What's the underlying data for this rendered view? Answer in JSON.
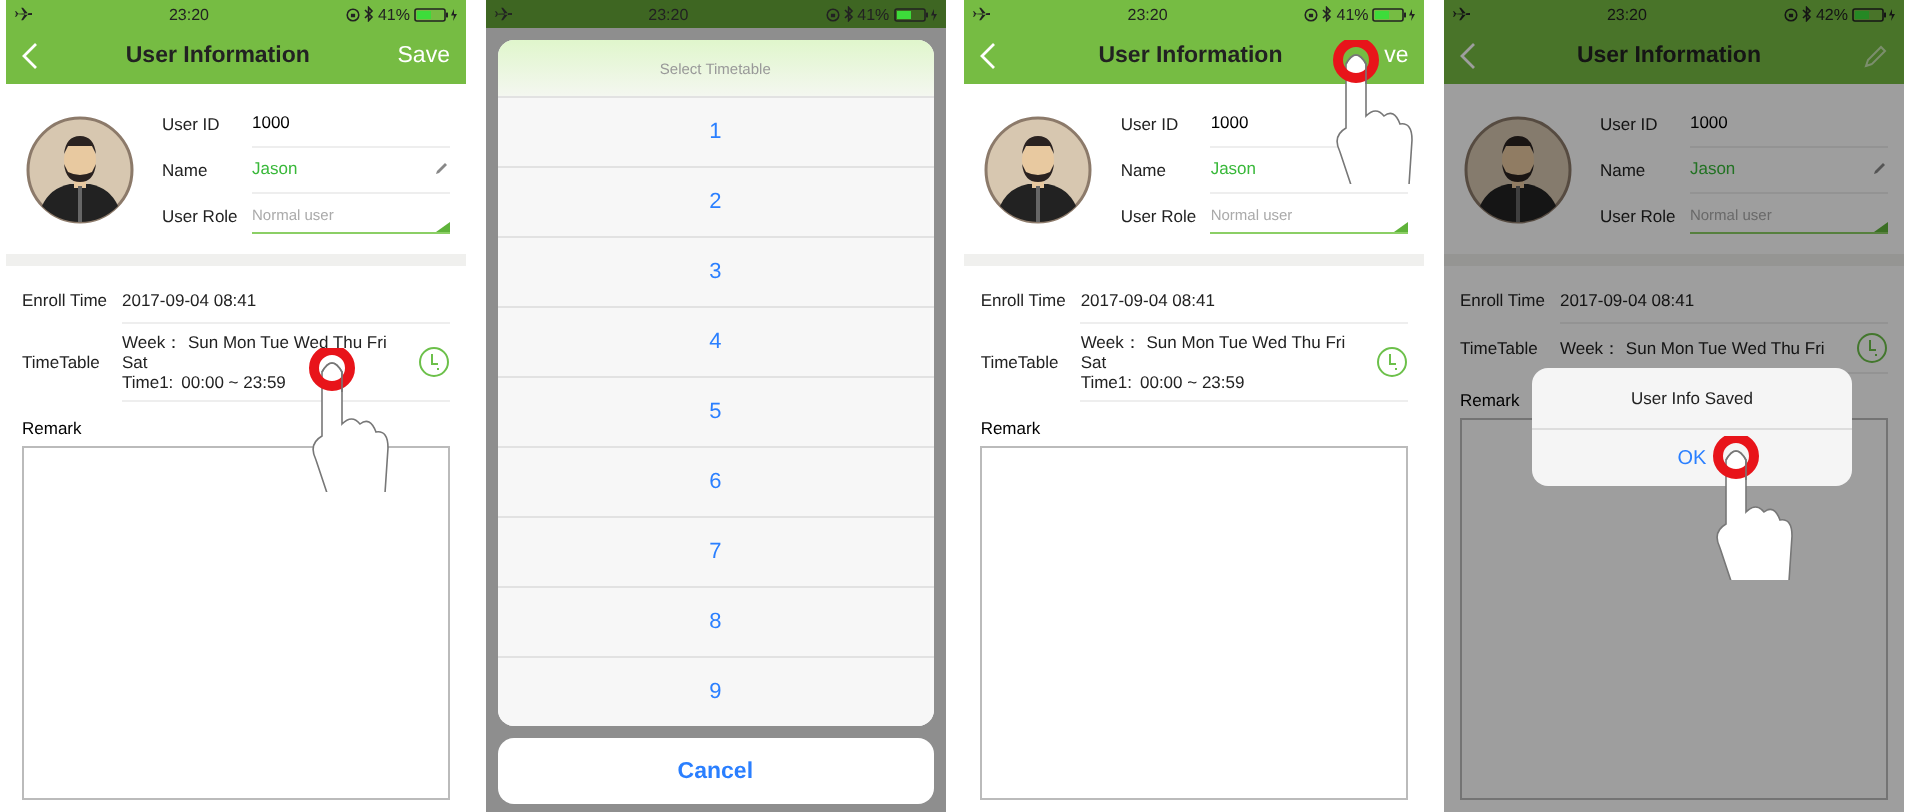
{
  "screens": [
    {
      "kind": "profile",
      "dimmed": false,
      "status": {
        "time": "23:20",
        "battery": "41%"
      },
      "nav": {
        "title": "User Information",
        "action": {
          "kind": "text",
          "label": "Save"
        }
      },
      "user": {
        "id_label": "User ID",
        "id": "1000",
        "name_label": "Name",
        "name": "Jason",
        "name_edit_icon": true,
        "role_label": "User Role",
        "role_placeholder": "Normal user"
      },
      "enroll": {
        "label": "Enroll Time",
        "value": "2017-09-04 08:41"
      },
      "timetable": {
        "label": "TimeTable",
        "week_label": "Week：",
        "week": "Sun Mon Tue Wed Thu Fri Sat",
        "time_label": "Time1:",
        "time": "00:00 ~ 23:59",
        "tapped": true
      },
      "remark": {
        "label": "Remark"
      }
    },
    {
      "kind": "picker",
      "status": {
        "time": "23:20",
        "battery": "41%"
      },
      "sheet": {
        "title": "Select Timetable",
        "items": [
          "1",
          "2",
          "3",
          "4",
          "5",
          "6",
          "7",
          "8",
          "9"
        ],
        "cancel": "Cancel"
      }
    },
    {
      "kind": "profile",
      "dimmed": false,
      "status": {
        "time": "23:20",
        "battery": "41%"
      },
      "nav": {
        "title": "User Information",
        "action": {
          "kind": "text",
          "label": "ve",
          "tapped": true
        }
      },
      "user": {
        "id_label": "User ID",
        "id": "1000",
        "name_label": "Name",
        "name": "Jason",
        "role_label": "User Role",
        "role_placeholder": "Normal user"
      },
      "enroll": {
        "label": "Enroll Time",
        "value": "2017-09-04 08:41"
      },
      "timetable": {
        "label": "TimeTable",
        "week_label": "Week：",
        "week": "Sun Mon Tue Wed Thu Fri Sat",
        "time_label": "Time1:",
        "time": "00:00 ~ 23:59"
      },
      "remark": {
        "label": "Remark"
      }
    },
    {
      "kind": "profile",
      "dimmed": true,
      "status": {
        "time": "23:20",
        "battery": "42%"
      },
      "nav": {
        "title": "User Information",
        "action": {
          "kind": "edit"
        }
      },
      "user": {
        "id_label": "User ID",
        "id": "1000",
        "name_label": "Name",
        "name": "Jason",
        "name_edit_icon": true,
        "role_label": "User Role",
        "role_placeholder": "Normal user"
      },
      "enroll": {
        "label": "Enroll Time",
        "value": "2017-09-04 08:41"
      },
      "timetable": {
        "label": "TimeTable",
        "week_label": "Week：",
        "week": "Sun Mon Tue Wed Thu Fri"
      },
      "remark": {
        "label": "Remark"
      },
      "alert": {
        "message": "User Info Saved",
        "button": "OK",
        "tapped": true
      }
    }
  ]
}
